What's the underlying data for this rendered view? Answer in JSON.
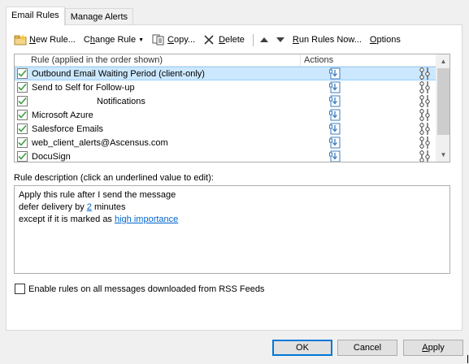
{
  "tabs": [
    {
      "label": "Email Rules",
      "active": true
    },
    {
      "label": "Manage Alerts",
      "active": false
    }
  ],
  "toolbar": {
    "new_rule": {
      "ul": "N",
      "rest": "ew Rule..."
    },
    "change_rule": {
      "pre": "C",
      "ul": "h",
      "rest": "ange Rule"
    },
    "copy": {
      "ul": "C",
      "rest": "opy..."
    },
    "delete": {
      "ul": "D",
      "rest": "elete"
    },
    "run_rules": {
      "ul": "R",
      "rest": "un Rules Now..."
    },
    "options": {
      "ul": "O",
      "rest": "ptions"
    }
  },
  "rules_list": {
    "col_rule": "Rule (applied in the order shown)",
    "col_actions": "Actions",
    "rows": [
      {
        "name": "Outbound Email Waiting Period  (client-only)",
        "checked": true,
        "selected": true
      },
      {
        "name": "Send to Self for Follow-up",
        "checked": true,
        "selected": false
      },
      {
        "name": "Notifications",
        "checked": true,
        "selected": false,
        "redacted_prefix": true
      },
      {
        "name": "Microsoft Azure",
        "checked": true,
        "selected": false
      },
      {
        "name": "Salesforce Emails",
        "checked": true,
        "selected": false
      },
      {
        "name": "web_client_alerts@Ascensus.com",
        "checked": true,
        "selected": false
      },
      {
        "name": "DocuSign",
        "checked": true,
        "selected": false
      }
    ]
  },
  "description": {
    "label": "Rule description (click an underlined value to edit):",
    "line1": "Apply this rule after I send the message",
    "line2_pre": "defer delivery by ",
    "line2_link": "2",
    "line2_post": " minutes",
    "line3_pre": "except if it is marked as ",
    "line3_link": "high importance"
  },
  "rss": {
    "label": "Enable rules on all messages downloaded from RSS Feeds",
    "checked": false
  },
  "buttons": {
    "ok": "OK",
    "cancel": "Cancel",
    "apply_ul": "A",
    "apply_rest": "pply"
  },
  "colors": {
    "accent": "#0078d7",
    "selection": "#cce8ff",
    "link": "#0066cc",
    "check": "#3c9f3c"
  }
}
